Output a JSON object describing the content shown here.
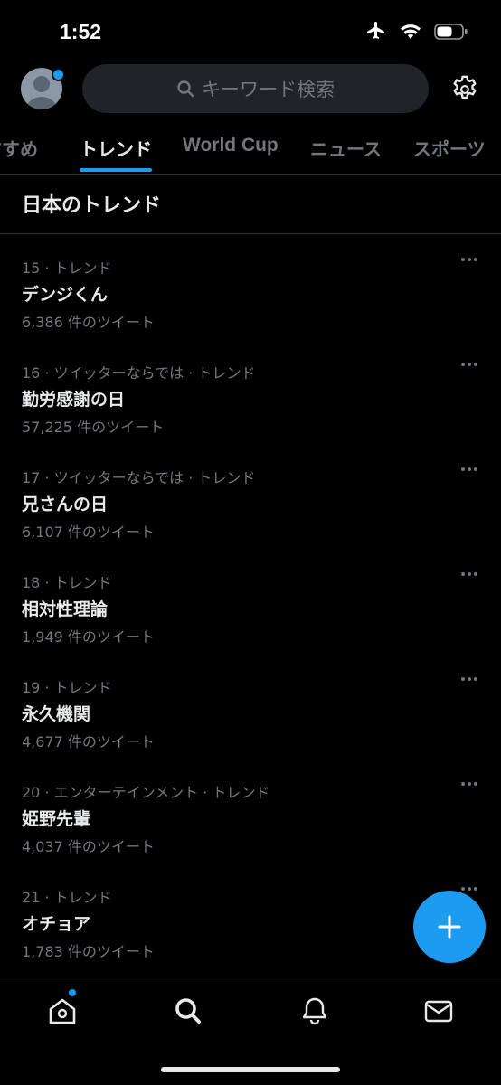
{
  "status_bar": {
    "time": "1:52"
  },
  "search": {
    "placeholder": "キーワード検索"
  },
  "tabs": [
    {
      "label": "すすめ"
    },
    {
      "label": "トレンド"
    },
    {
      "label": "World Cup"
    },
    {
      "label": "ニュース"
    },
    {
      "label": "スポーツ"
    }
  ],
  "section_title": "日本のトレンド",
  "trends": [
    {
      "meta": "15 · トレンド",
      "name": "デンジくん",
      "count": "6,386 件のツイート"
    },
    {
      "meta": "16 · ツイッターならでは · トレンド",
      "name": "勤労感謝の日",
      "count": "57,225 件のツイート"
    },
    {
      "meta": "17 · ツイッターならでは · トレンド",
      "name": "兄さんの日",
      "count": "6,107 件のツイート"
    },
    {
      "meta": "18 · トレンド",
      "name": "相対性理論",
      "count": "1,949 件のツイート"
    },
    {
      "meta": "19 · トレンド",
      "name": "永久機関",
      "count": "4,677 件のツイート"
    },
    {
      "meta": "20 · エンターテインメント · トレンド",
      "name": "姫野先輩",
      "count": "4,037 件のツイート"
    },
    {
      "meta": "21 · トレンド",
      "name": "オチョア",
      "count": "1,783 件のツイート"
    }
  ],
  "colors": {
    "accent": "#1d9bf0",
    "background": "#000000",
    "muted_text": "#71767b"
  },
  "icons": [
    "airplane-icon",
    "wifi-icon",
    "battery-icon",
    "search-icon",
    "gear-icon",
    "plus-icon",
    "home-icon",
    "bell-icon",
    "mail-icon"
  ]
}
